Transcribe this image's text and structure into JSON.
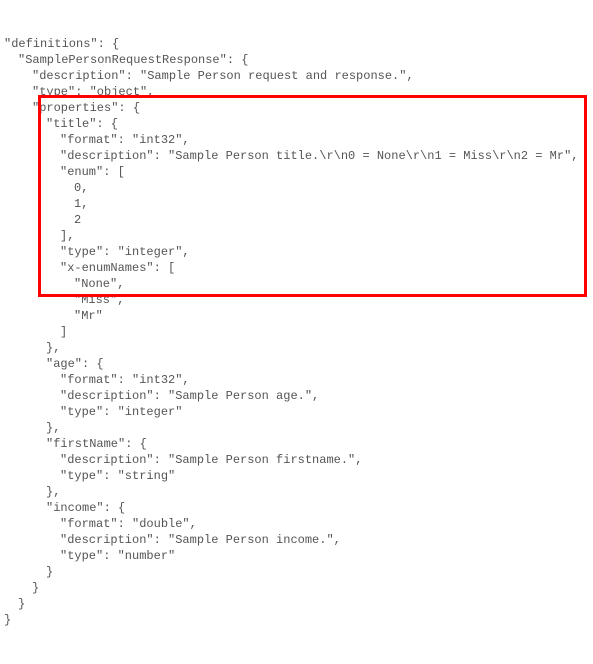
{
  "lines": [
    {
      "indent": 0,
      "text": "\"definitions\": {"
    },
    {
      "indent": 1,
      "text": "\"SamplePersonRequestResponse\": {"
    },
    {
      "indent": 2,
      "text": "\"description\": \"Sample Person request and response.\","
    },
    {
      "indent": 2,
      "text": "\"type\": \"object\","
    },
    {
      "indent": 2,
      "text": "\"properties\": {"
    },
    {
      "indent": 3,
      "text": "\"title\": {"
    },
    {
      "indent": 4,
      "text": "\"format\": \"int32\","
    },
    {
      "indent": 4,
      "text": "\"description\": \"Sample Person title.\\r\\n0 = None\\r\\n1 = Miss\\r\\n2 = Mr\","
    },
    {
      "indent": 4,
      "text": "\"enum\": ["
    },
    {
      "indent": 5,
      "text": "0,"
    },
    {
      "indent": 5,
      "text": "1,"
    },
    {
      "indent": 5,
      "text": "2"
    },
    {
      "indent": 4,
      "text": "],"
    },
    {
      "indent": 4,
      "text": "\"type\": \"integer\","
    },
    {
      "indent": 4,
      "text": "\"x-enumNames\": ["
    },
    {
      "indent": 5,
      "text": "\"None\","
    },
    {
      "indent": 5,
      "text": "\"Miss\","
    },
    {
      "indent": 5,
      "text": "\"Mr\""
    },
    {
      "indent": 4,
      "text": "]"
    },
    {
      "indent": 3,
      "text": "},"
    },
    {
      "indent": 3,
      "text": "\"age\": {"
    },
    {
      "indent": 4,
      "text": "\"format\": \"int32\","
    },
    {
      "indent": 4,
      "text": "\"description\": \"Sample Person age.\","
    },
    {
      "indent": 4,
      "text": "\"type\": \"integer\""
    },
    {
      "indent": 3,
      "text": "},"
    },
    {
      "indent": 3,
      "text": "\"firstName\": {"
    },
    {
      "indent": 4,
      "text": "\"description\": \"Sample Person firstname.\","
    },
    {
      "indent": 4,
      "text": "\"type\": \"string\""
    },
    {
      "indent": 3,
      "text": "},"
    },
    {
      "indent": 3,
      "text": "\"income\": {"
    },
    {
      "indent": 4,
      "text": "\"format\": \"double\","
    },
    {
      "indent": 4,
      "text": "\"description\": \"Sample Person income.\","
    },
    {
      "indent": 4,
      "text": "\"type\": \"number\""
    },
    {
      "indent": 3,
      "text": "}"
    },
    {
      "indent": 2,
      "text": "}"
    },
    {
      "indent": 1,
      "text": "}"
    },
    {
      "indent": 0,
      "text": "}"
    }
  ]
}
